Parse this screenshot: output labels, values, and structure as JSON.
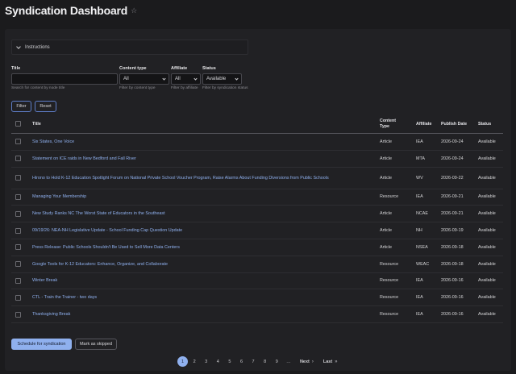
{
  "header": {
    "title": "Syndication Dashboard"
  },
  "instructions": {
    "label": "Instructions"
  },
  "filters": {
    "title": {
      "label": "Title",
      "value": "",
      "help": "Search for content by node title"
    },
    "content_type": {
      "label": "Content type",
      "value": "All",
      "help": "Filter by content type"
    },
    "affiliate": {
      "label": "Affiliate",
      "value": "All",
      "help": "Filter by affiliate"
    },
    "status": {
      "label": "Status",
      "value": "Available",
      "help": "Filter by syndication status"
    }
  },
  "buttons": {
    "filter": "Filter",
    "reset": "Reset",
    "schedule": "Schedule for syndication",
    "skip": "Mark as skipped"
  },
  "table": {
    "headers": {
      "title": "Title",
      "content_type": "Content Type",
      "affiliate": "Affiliate",
      "publish_date": "Publish Date",
      "status": "Status"
    },
    "rows": [
      {
        "title": "Six States, One Voice",
        "type": "Article",
        "affiliate": "IEA",
        "date": "2026-09-24",
        "status": "Available"
      },
      {
        "title": "Statement on ICE raids in New Bedford and Fall River",
        "type": "Article",
        "affiliate": "MTA",
        "date": "2026-09-24",
        "status": "Available"
      },
      {
        "title": "Hirono to Hold K-12 Education Spotlight Forum on National Private School Voucher Program, Raise Alarms About Funding Diversions from Public Schools",
        "type": "Article",
        "affiliate": "WV",
        "date": "2026-09-22",
        "status": "Available"
      },
      {
        "title": "Managing Your Membership",
        "type": "Resource",
        "affiliate": "IEA",
        "date": "2026-09-21",
        "status": "Available"
      },
      {
        "title": "New Study Ranks NC The Worst State of Educators in the Southeast",
        "type": "Article",
        "affiliate": "NCAE",
        "date": "2026-09-21",
        "status": "Available"
      },
      {
        "title": "09/19/26: NEA-NH Legislative Update - School Funding Cap Question Update",
        "type": "Article",
        "affiliate": "NH",
        "date": "2026-09-19",
        "status": "Available"
      },
      {
        "title": "Press Release: Public Schools Shouldn't Be Used to Sell More Data Centers",
        "type": "Article",
        "affiliate": "NSEA",
        "date": "2026-09-18",
        "status": "Available"
      },
      {
        "title": "Google Tools for K-12 Educators: Enhance, Organize, and Collaborate",
        "type": "Resource",
        "affiliate": "WEAC",
        "date": "2026-09-18",
        "status": "Available"
      },
      {
        "title": "Winter Break",
        "type": "Resource",
        "affiliate": "IEA",
        "date": "2026-09-16",
        "status": "Available"
      },
      {
        "title": "CTL - Train the Trainer - two days",
        "type": "Resource",
        "affiliate": "IEA",
        "date": "2026-09-16",
        "status": "Available"
      },
      {
        "title": "Thanksgiving Break",
        "type": "Resource",
        "affiliate": "IEA",
        "date": "2026-09-16",
        "status": "Available"
      }
    ]
  },
  "pager": {
    "pages": [
      "1",
      "2",
      "3",
      "4",
      "5",
      "6",
      "7",
      "8",
      "9"
    ],
    "ellipsis": "…",
    "next": "Next",
    "last": "Last",
    "current": "1"
  }
}
